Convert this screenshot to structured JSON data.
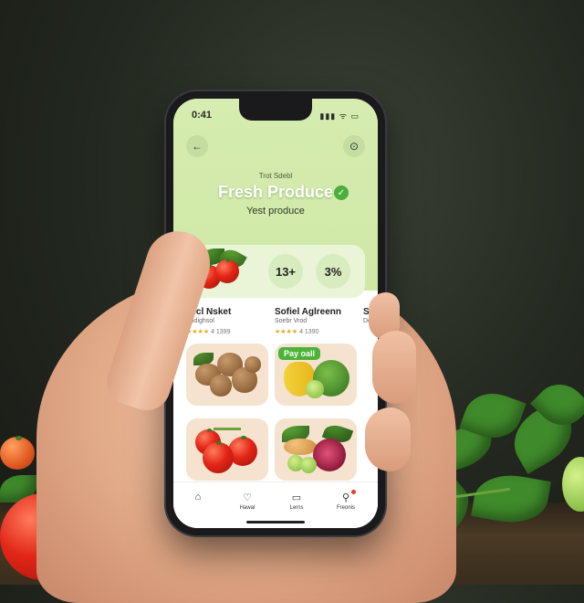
{
  "status_bar": {
    "time": "0:41",
    "signal": "▮▮▮ ᯤ ▭"
  },
  "header": {
    "back_icon": "←",
    "right_icon": "⊙",
    "small_title": "Trot Sdebl",
    "title": "Fresh Produce",
    "check_icon": "✓",
    "subtitle": "Yest produce"
  },
  "stats": [
    {
      "value": "13+"
    },
    {
      "value": "3%"
    }
  ],
  "sections": [
    {
      "title": "Tecl Nsket",
      "sub": "Bodighsol",
      "rating": "★★★★",
      "rating_text": "4 1399"
    },
    {
      "title": "Sofiel Aglreenn",
      "sub": "Soebr Vrod",
      "rating": "★★★★",
      "rating_text": "4 1390"
    },
    {
      "title": "So",
      "sub": "De"
    }
  ],
  "tiles": [
    {
      "badge": ""
    },
    {
      "badge": "Pay oall"
    },
    {
      "badge": ""
    },
    {
      "badge": ""
    }
  ],
  "tabs": [
    {
      "icon": "⌂",
      "label": ""
    },
    {
      "icon": "♡",
      "label": "Hawal"
    },
    {
      "icon": "▭",
      "label": "Lerns"
    },
    {
      "icon": "⚲",
      "label": "Freonis"
    }
  ],
  "colors": {
    "accent": "#4cb338",
    "hero_bg": "#d6ecb0",
    "tile_bg": "#f6e3cf"
  }
}
